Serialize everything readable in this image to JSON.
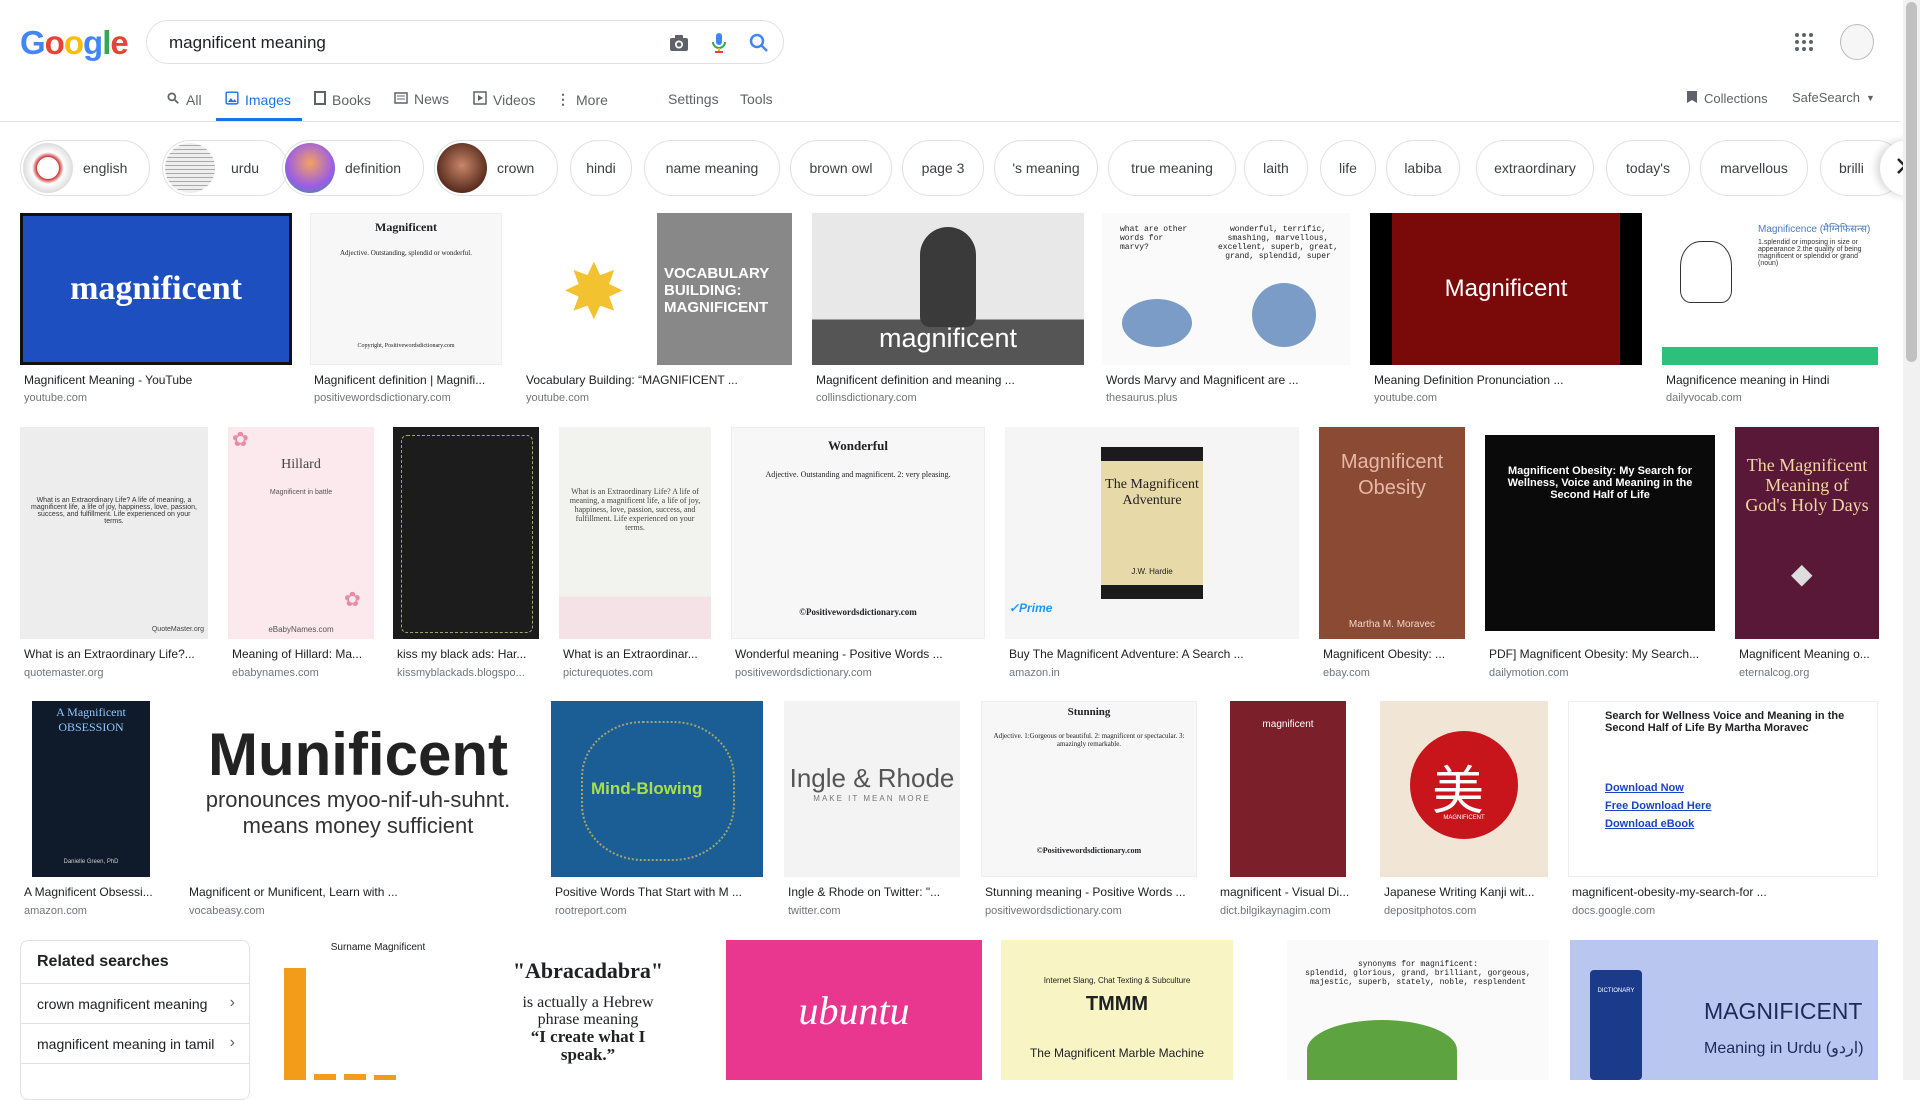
{
  "logo": {
    "letters": [
      "G",
      "o",
      "o",
      "g",
      "l",
      "e"
    ],
    "colors": [
      "#4285f4",
      "#ea4335",
      "#fbbc05",
      "#4285f4",
      "#34a853",
      "#ea4335"
    ]
  },
  "search": {
    "value": "magnificent meaning",
    "icons": [
      "camera-icon",
      "mic-icon",
      "search-icon"
    ]
  },
  "nav": {
    "tabs": [
      {
        "label": "All",
        "icon": "search-icon"
      },
      {
        "label": "Images",
        "icon": "image-icon",
        "active": true
      },
      {
        "label": "Books",
        "icon": "book-icon"
      },
      {
        "label": "News",
        "icon": "news-icon"
      },
      {
        "label": "Videos",
        "icon": "video-icon"
      },
      {
        "label": "More",
        "icon": "more-vert-icon"
      }
    ],
    "settings": "Settings",
    "tools": "Tools",
    "collections": "Collections",
    "safesearch": "SafeSearch"
  },
  "chips": [
    {
      "label": "english",
      "thumb": true
    },
    {
      "label": "urdu",
      "thumb": true
    },
    {
      "label": "definition",
      "thumb": true
    },
    {
      "label": "crown",
      "thumb": true
    },
    {
      "label": "hindi"
    },
    {
      "label": "name meaning"
    },
    {
      "label": "brown owl"
    },
    {
      "label": "page 3"
    },
    {
      "label": "'s meaning"
    },
    {
      "label": "true meaning"
    },
    {
      "label": "laith"
    },
    {
      "label": "life"
    },
    {
      "label": "labiba"
    },
    {
      "label": "extraordinary"
    },
    {
      "label": "today's"
    },
    {
      "label": "marvellous"
    },
    {
      "label": "brilli"
    }
  ],
  "results": {
    "row1": [
      {
        "caption": "Magnificent Meaning - YouTube",
        "source": "youtube.com",
        "img_text": "magnificent"
      },
      {
        "caption": "Magnificent definition | Magnifi...",
        "source": "positivewordsdictionary.com",
        "img_text": "Magnificent",
        "img_sub": "Adjective. Outstanding, splendid or wonderful.",
        "img_foot": "Copyright, Positivewordsdictionary.com"
      },
      {
        "caption": "Vocabulary Building: “MAGNIFICENT ...",
        "source": "youtube.com",
        "img_text": "VOCABULARY BUILDING: MAGNIFICENT"
      },
      {
        "caption": "Magnificent definition and meaning ...",
        "source": "collinsdictionary.com",
        "img_text": "magnificent"
      },
      {
        "caption": "Words Marvy and Magnificent are ...",
        "source": "thesaurus.plus",
        "img_text": "what are other words for marvy?",
        "img_sub": "wonderful, terrific, smashing, marvellous, excellent, superb, great, grand, splendid, super"
      },
      {
        "caption": "Meaning Definition Pronunciation ...",
        "source": "youtube.com",
        "img_text": "Magnificent"
      },
      {
        "caption": "Magnificence meaning in Hindi",
        "source": "dailyvocab.com",
        "img_text": "Magnificence (मैग्निफिसन्स)",
        "img_sub": "1.splendid or imposing in size or appearance 2.the quality of being magnificent or splendid or grand (noun)"
      }
    ],
    "row2": [
      {
        "caption": "What is an Extraordinary Life?...",
        "source": "quotemaster.org",
        "img_text": "What is an Extraordinary Life? A life of meaning, a magnificent life, a life of joy, happiness, love, passion, success, and fulfillment. Life experienced on your terms.",
        "img_foot": "QuoteMaster.org"
      },
      {
        "caption": "Meaning of Hillard: Ma...",
        "source": "ebabynames.com",
        "img_text": "Hillard",
        "img_sub": "Magnificent in battle",
        "img_foot": "eBabyNames.com"
      },
      {
        "caption": "kiss my black ads: Har...",
        "source": "kissmyblackads.blogspo..."
      },
      {
        "caption": "What is an Extraordinar...",
        "source": "picturequotes.com",
        "img_text": "What is an Extraordinary Life? A life of meaning, a magnificent life, a life of joy, happiness, love, passion, success, and fulfillment. Life experienced on your terms."
      },
      {
        "caption": "Wonderful meaning - Positive Words ...",
        "source": "positivewordsdictionary.com",
        "img_text": "Wonderful",
        "img_sub": "Adjective. Outstanding and magnificent. 2: very pleasing.",
        "img_foot": "©Positivewordsdictionary.com"
      },
      {
        "caption": "Buy The Magnificent Adventure: A Search ...",
        "source": "amazon.in",
        "img_text": "The Magnificent Adventure",
        "img_foot": "J.W. Hardie"
      },
      {
        "caption": "Magnificent Obesity: ...",
        "source": "ebay.com",
        "img_text": "Magnificent Obesity",
        "img_foot": "Martha M. Moravec"
      },
      {
        "caption": "PDF] Magnificent Obesity: My Search...",
        "source": "dailymotion.com",
        "img_text": "Magnificent Obesity: My Search for Wellness, Voice and Meaning in the Second Half of Life"
      },
      {
        "caption": "Magnificent Meaning o...",
        "source": "eternalcog.org",
        "img_text": "The Magnificent Meaning of God's Holy Days"
      }
    ],
    "row3": [
      {
        "caption": "A Magnificent Obsessi...",
        "source": "amazon.com",
        "img_text": "A Magnificent OBSESSION",
        "img_foot": "Danielle Green, PhD"
      },
      {
        "caption": "Magnificent or Munificent, Learn with ...",
        "source": "vocabeasy.com",
        "img_text": "Munificent",
        "img_sub": "pronounces myoo-nif-uh-suhnt.",
        "img_foot": "means money sufficient"
      },
      {
        "caption": "Positive Words That Start with M ...",
        "source": "rootreport.com",
        "img_text": "Mind-Blowing"
      },
      {
        "caption": "Ingle & Rhode on Twitter: \"...",
        "source": "twitter.com",
        "img_text": "Ingle & Rhode",
        "img_sub": "MAKE IT MEAN MORE"
      },
      {
        "caption": "Stunning meaning - Positive Words ...",
        "source": "positivewordsdictionary.com",
        "img_text": "Stunning",
        "img_sub": "Adjective. 1:Gorgeous or beautiful. 2: magnificent or spectacular. 3: amazingly remarkable.",
        "img_foot": "©Positivewordsdictionary.com"
      },
      {
        "caption": "magnificent - Visual Di...",
        "source": "dict.bilgikaynagim.com",
        "img_text": "magnificent"
      },
      {
        "caption": "Japanese Writing Kanji wit...",
        "source": "depositphotos.com",
        "img_text": "MAGNIFICENT"
      },
      {
        "caption": "magnificent-obesity-my-search-for ...",
        "source": "docs.google.com",
        "img_text": "Search for Wellness Voice and Meaning in the Second Half of Life By Martha Moravec",
        "img_links": [
          "Download Now",
          "Free Download Here",
          "Download eBook"
        ]
      }
    ],
    "row4": [
      {
        "img_text": "Surname Magnificent"
      },
      {
        "img_text": "\"Abracadabra\"",
        "img_sub": "is actually a Hebrew phrase meaning",
        "img_foot": "“I create what I speak.”"
      },
      {
        "img_text": "ubuntu"
      },
      {
        "img_text": "TMMM",
        "img_sub": "Internet Slang, Chat Texting & Subculture",
        "img_foot": "The Magnificent Marble Machine"
      },
      {
        "img_text": "synonyms for magnificent:",
        "img_sub": "splendid, glorious, grand, brilliant, gorgeous, majestic, superb, stately, noble, resplendent"
      },
      {
        "img_text": "MAGNIFICENT",
        "img_sub": "Meaning in Urdu (اردو)",
        "img_foot": "DICTIONARY"
      }
    ]
  },
  "related": {
    "title": "Related searches",
    "items": [
      "crown magnificent meaning",
      "magnificent meaning in tamil"
    ]
  },
  "colors": {
    "accent": "#1a73e8",
    "text": "#202124",
    "muted": "#70757a",
    "border": "#dfe1e5"
  }
}
